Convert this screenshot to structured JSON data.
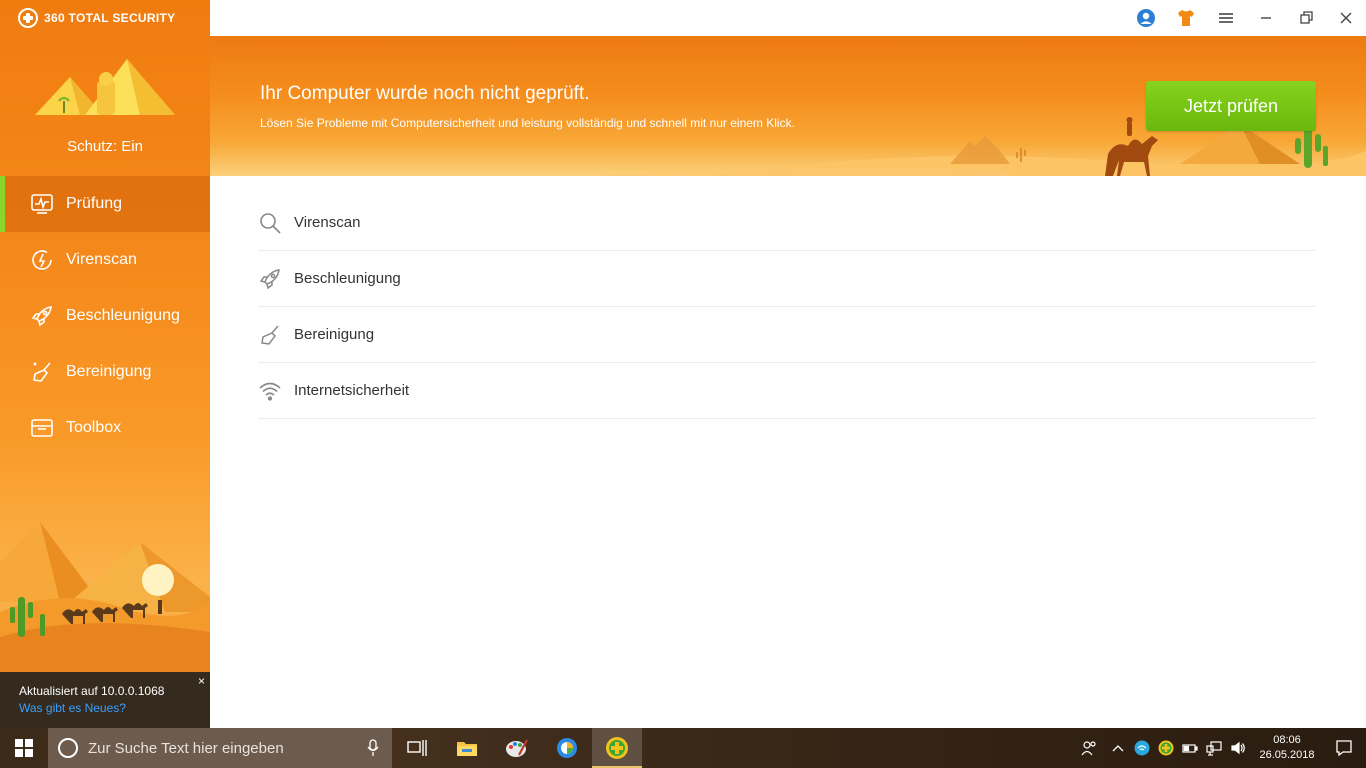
{
  "app": {
    "brand": "360 TOTAL SECURITY",
    "colors": {
      "accent": "#f5881a",
      "cta": "#7cc61a",
      "active_bar": "#8bd62a",
      "link": "#3aa0ff"
    }
  },
  "sidebar": {
    "status": "Schutz: Ein",
    "items": [
      {
        "label": "Prüfung",
        "icon": "pulse-monitor-icon",
        "active": true
      },
      {
        "label": "Virenscan",
        "icon": "lightning-circle-icon",
        "active": false
      },
      {
        "label": "Beschleunigung",
        "icon": "rocket-icon",
        "active": false
      },
      {
        "label": "Bereinigung",
        "icon": "broom-icon",
        "active": false
      },
      {
        "label": "Toolbox",
        "icon": "toolbox-icon",
        "active": false
      }
    ],
    "update": {
      "text": "Aktualisiert auf 10.0.0.1068",
      "link": "Was gibt es Neues?",
      "close": "×"
    }
  },
  "titlebar": {
    "icons": [
      "user-account-icon",
      "skin-shirt-icon",
      "menu-icon",
      "minimize-icon",
      "restore-icon",
      "close-icon"
    ]
  },
  "banner": {
    "title": "Ihr Computer wurde noch nicht geprüft.",
    "subtitle": "Lösen Sie Probleme mit Computersicherheit und leistung vollständig und schnell mit nur einem Klick.",
    "cta": "Jetzt prüfen"
  },
  "checklist": [
    {
      "label": "Virenscan",
      "icon": "magnifier-icon"
    },
    {
      "label": "Beschleunigung",
      "icon": "rocket-icon"
    },
    {
      "label": "Bereinigung",
      "icon": "broom-icon"
    },
    {
      "label": "Internetsicherheit",
      "icon": "wifi-icon"
    }
  ],
  "taskbar": {
    "search_placeholder": "Zur Suche Text hier eingeben",
    "clock_time": "08:06",
    "clock_date": "26.05.2018"
  }
}
